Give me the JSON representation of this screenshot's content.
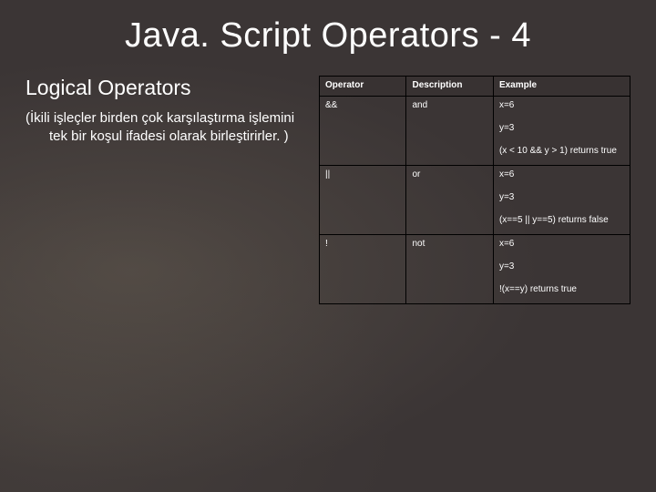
{
  "title": "Java. Script Operators - 4",
  "subheading": "Logical Operators",
  "description_open": "(",
  "description_body": "İkili işleçler birden çok karşılaştırma işlemini tek bir koşul ifadesi olarak birleştirirler. )",
  "table": {
    "headers": [
      "Operator",
      "Description",
      "Example"
    ],
    "rows": [
      {
        "op": "&&",
        "desc": "and",
        "ex1": "x=6",
        "ex2": "y=3",
        "ex3": "(x < 10 && y > 1) returns true"
      },
      {
        "op": "||",
        "desc": "or",
        "ex1": "x=6",
        "ex2": "y=3",
        "ex3": "(x==5 || y==5) returns false"
      },
      {
        "op": "!",
        "desc": "not",
        "ex1": "x=6",
        "ex2": "y=3",
        "ex3": "!(x==y) returns true"
      }
    ]
  }
}
